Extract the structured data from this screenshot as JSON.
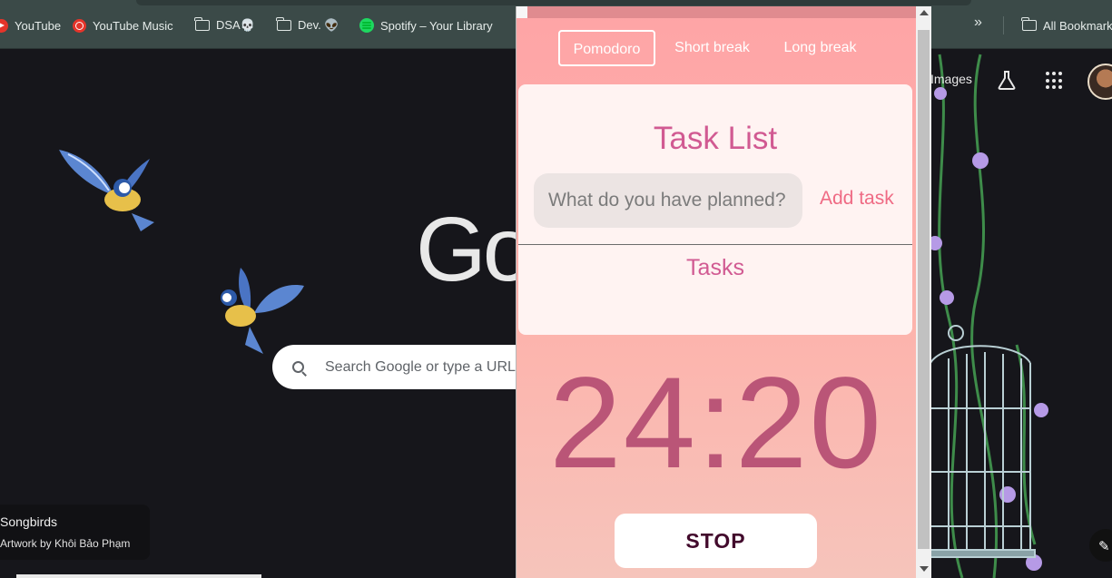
{
  "bookmarks_bar": {
    "items": [
      {
        "label": "YouTube",
        "icon": "youtube-icon"
      },
      {
        "label": "YouTube Music",
        "icon": "youtube-music-icon"
      },
      {
        "label": "DSA💀",
        "icon": "folder-icon"
      },
      {
        "label": "Dev. 👽",
        "icon": "folder-icon"
      },
      {
        "label": "Spotify – Your Library",
        "icon": "spotify-icon"
      }
    ],
    "more_label": "»",
    "all_bookmarks_label": "All Bookmarks"
  },
  "new_tab": {
    "logo_text": "Go",
    "search_placeholder": "Search Google or type a URL",
    "top_link": "Images",
    "artwork_title": "Songbirds",
    "artwork_credit": "Artwork by Khôi Bảo Phạm"
  },
  "popup": {
    "modes": [
      "Pomodoro",
      "Short break",
      "Long break"
    ],
    "active_mode": "Pomodoro",
    "task_list_title": "Task List",
    "task_input_placeholder": "What do you have planned?",
    "add_task_label": "Add task",
    "tasks_heading": "Tasks",
    "timer": "24:20",
    "stop_label": "STOP"
  },
  "colors": {
    "popup_bg_top": "#fea4a6",
    "accent_pink": "#d15a92",
    "timer_color": "#ba5577",
    "add_task_color": "#ef6a84",
    "stop_text": "#420a2c"
  }
}
